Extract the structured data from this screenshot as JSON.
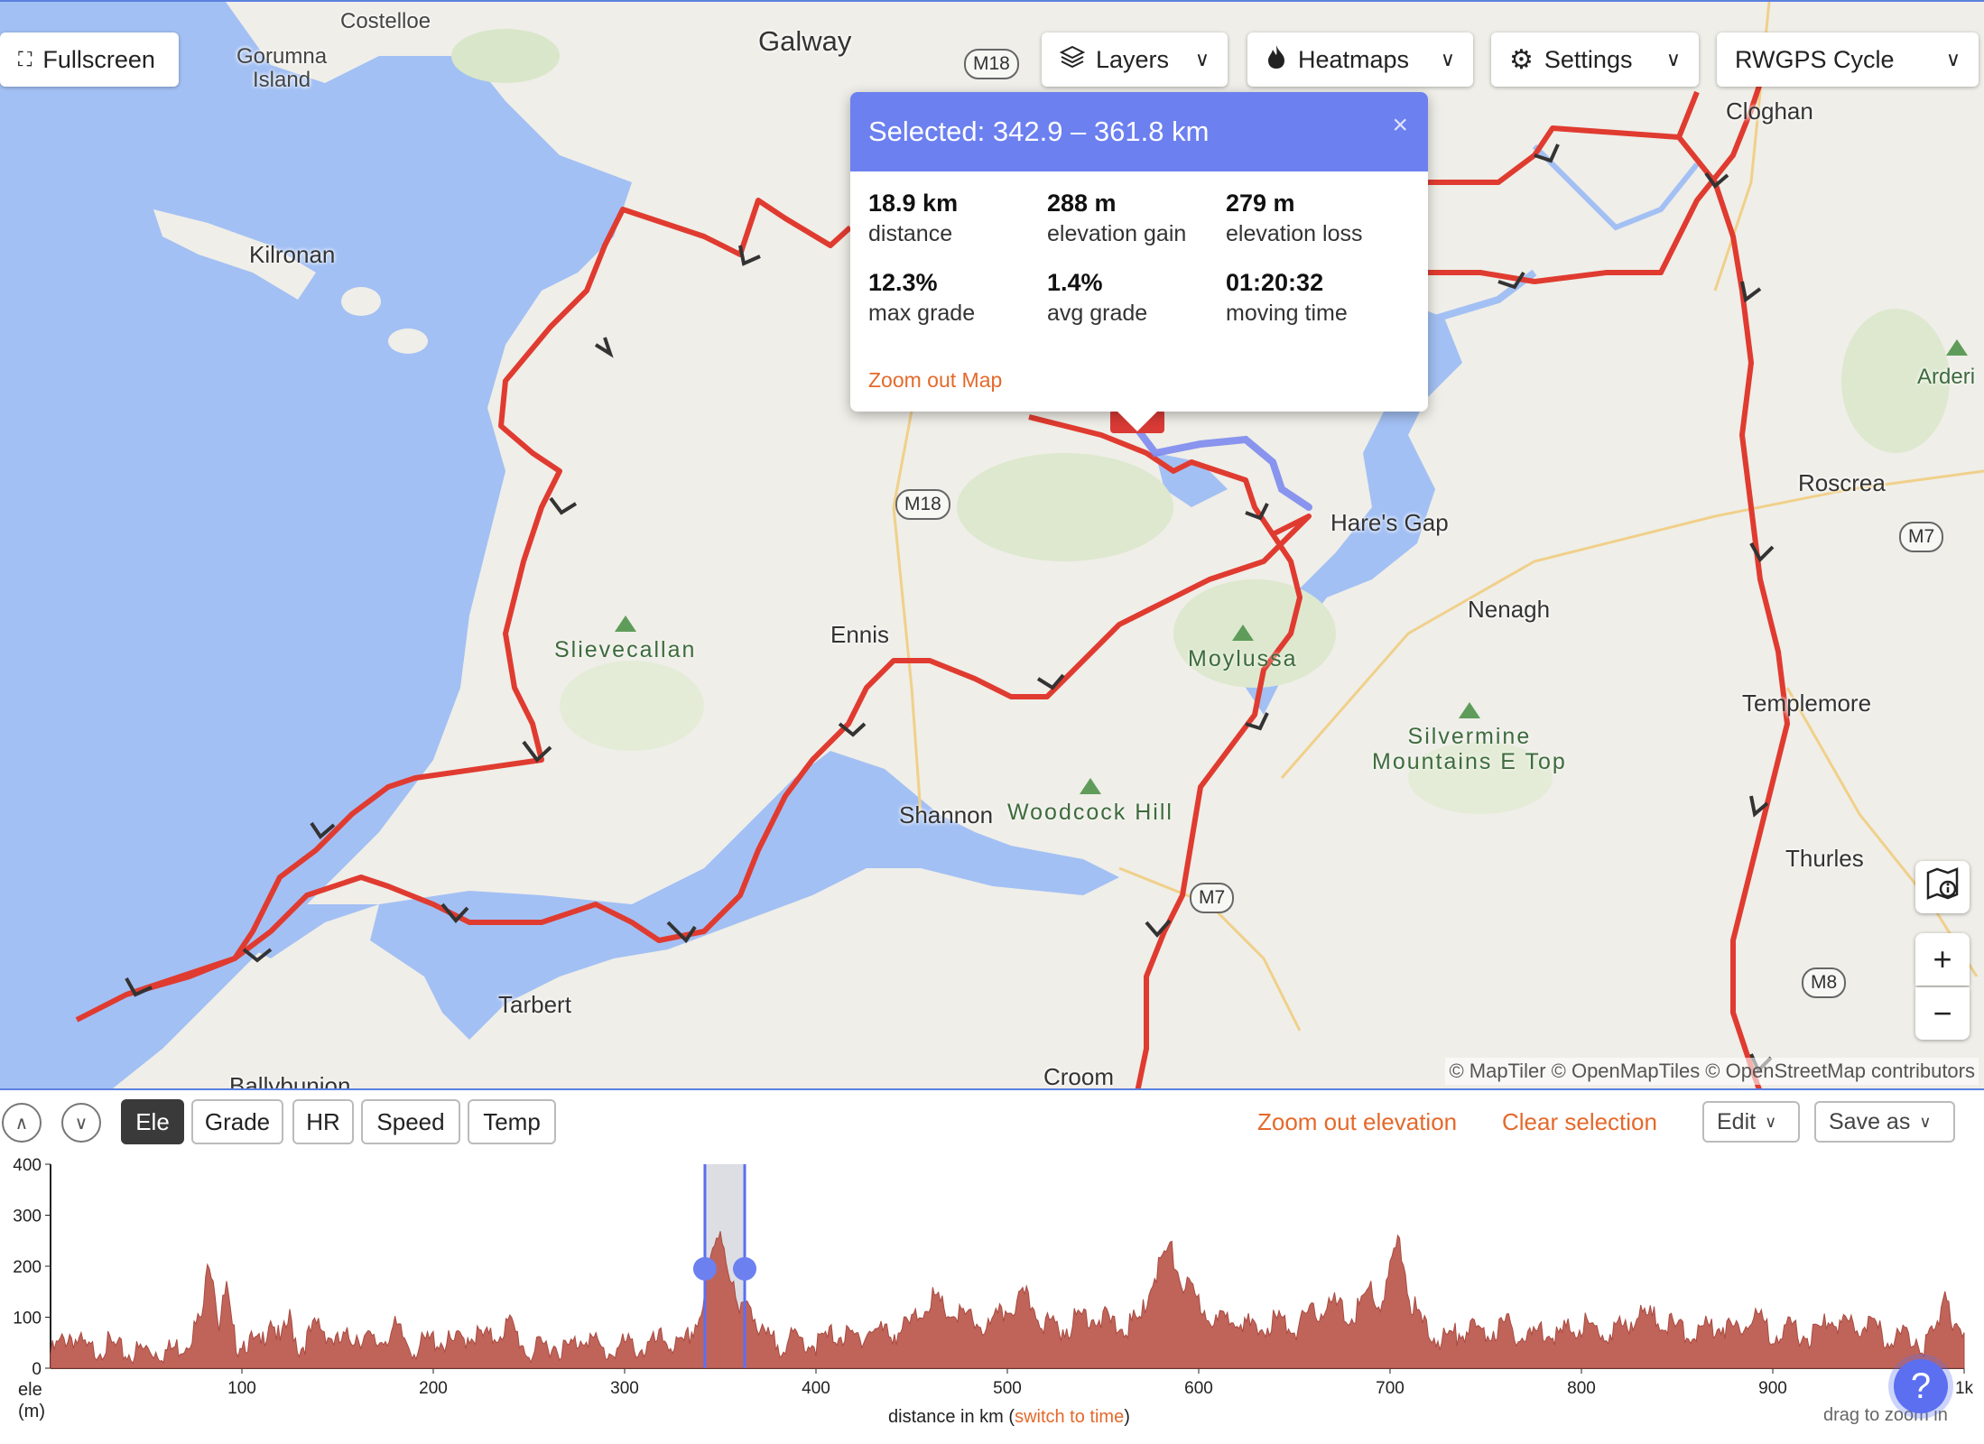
{
  "map": {
    "controls": {
      "fullscreen_label": "Fullscreen",
      "layers_label": "Layers",
      "heatmaps_label": "Heatmaps",
      "settings_label": "Settings",
      "style_label": "RWGPS Cycle"
    },
    "places": {
      "costelloe": "Costelloe",
      "gorumna_1": "Gorumna",
      "gorumna_2": "Island",
      "galway": "Galway",
      "kilronan": "Kilronan",
      "cloghan": "Cloghan",
      "roscrea": "Roscrea",
      "hares_gap": "Hare's Gap",
      "ennis": "Ennis",
      "nenagh": "Nenagh",
      "templemore": "Templemore",
      "shannon": "Shannon",
      "thurles": "Thurles",
      "tarbert": "Tarbert",
      "ballybunion": "Ballybunion",
      "croom": "Croom",
      "arderin": "Arderi"
    },
    "peaks": {
      "slievecallan": "Slievecallan",
      "moylussa": "Moylussa",
      "silvermine_1": "Silvermine",
      "silvermine_2": "Mountains E Top",
      "woodcock": "Woodcock Hill"
    },
    "roads": {
      "m18_top": "M18",
      "m18_mid": "M18",
      "m7_east": "M7",
      "m7_south": "M7",
      "m8": "M8"
    },
    "attribution": "© MapTiler © OpenMapTiles © OpenStreetMap contributors",
    "colors": {
      "water": "#a3c0f4",
      "land": "#efeee8",
      "route": "#e03b30",
      "selection": "#7684ee"
    }
  },
  "popup": {
    "title": "Selected: 342.9 – 361.8 km",
    "close_icon": "×",
    "stats": [
      {
        "value": "18.9 km",
        "label": "distance"
      },
      {
        "value": "288 m",
        "label": "elevation gain"
      },
      {
        "value": "279 m",
        "label": "elevation loss"
      },
      {
        "value": "12.3%",
        "label": "max grade"
      },
      {
        "value": "1.4%",
        "label": "avg grade"
      },
      {
        "value": "01:20:32",
        "label": "moving time"
      }
    ],
    "zoom_link": "Zoom out Map"
  },
  "toolbar": {
    "tabs": [
      "Ele",
      "Grade",
      "HR",
      "Speed",
      "Temp"
    ],
    "active_tab": "Ele",
    "zoom_out_elevation": "Zoom out elevation",
    "clear_selection": "Clear selection",
    "edit_label": "Edit",
    "save_label": "Save as"
  },
  "chart_data": {
    "type": "area",
    "ylabel_1": "ele",
    "ylabel_2": "(m)",
    "xlabel_prefix": "distance in km (",
    "xlabel_link": "switch to time",
    "xlabel_suffix": ")",
    "drag_hint": "drag to zoom in",
    "yticks": [
      "0",
      "100",
      "200",
      "300",
      "400"
    ],
    "xticks": [
      "100",
      "200",
      "300",
      "400",
      "500",
      "600",
      "700",
      "800",
      "900",
      "1k"
    ],
    "xlim": [
      0,
      1000
    ],
    "ylim": [
      0,
      400
    ],
    "selection_km": [
      342.9,
      361.8
    ],
    "profile_km": [
      0,
      10,
      20,
      30,
      40,
      50,
      60,
      70,
      80,
      82,
      85,
      88,
      92,
      95,
      98,
      100,
      110,
      115,
      120,
      125,
      130,
      140,
      150,
      160,
      170,
      180,
      190,
      200,
      210,
      220,
      230,
      240,
      250,
      260,
      270,
      280,
      290,
      300,
      310,
      320,
      330,
      340,
      345,
      350,
      355,
      360,
      365,
      370,
      380,
      390,
      400,
      410,
      420,
      430,
      440,
      450,
      460,
      470,
      480,
      490,
      500,
      510,
      520,
      530,
      540,
      550,
      560,
      570,
      575,
      580,
      585,
      590,
      600,
      610,
      620,
      630,
      640,
      650,
      660,
      670,
      680,
      690,
      695,
      700,
      705,
      710,
      720,
      730,
      740,
      750,
      760,
      770,
      780,
      790,
      800,
      810,
      820,
      830,
      840,
      850,
      860,
      870,
      880,
      890,
      900,
      910,
      920,
      930,
      940,
      950,
      960,
      970,
      980,
      985,
      990,
      995,
      1000
    ],
    "profile_ele": [
      40,
      80,
      45,
      60,
      40,
      50,
      45,
      60,
      120,
      240,
      200,
      100,
      170,
      80,
      60,
      70,
      55,
      120,
      60,
      110,
      50,
      100,
      60,
      80,
      60,
      90,
      50,
      70,
      60,
      80,
      70,
      100,
      40,
      60,
      50,
      80,
      40,
      60,
      50,
      70,
      50,
      120,
      220,
      290,
      200,
      110,
      160,
      80,
      60,
      70,
      60,
      80,
      70,
      90,
      80,
      100,
      150,
      120,
      110,
      90,
      130,
      150,
      100,
      90,
      120,
      110,
      90,
      110,
      180,
      220,
      250,
      190,
      140,
      100,
      120,
      80,
      110,
      90,
      120,
      140,
      110,
      170,
      130,
      200,
      270,
      150,
      80,
      70,
      90,
      80,
      100,
      70,
      90,
      80,
      100,
      80,
      90,
      120,
      110,
      90,
      80,
      100,
      90,
      120,
      80,
      90,
      70,
      110,
      90,
      100,
      70,
      80,
      60,
      80,
      180,
      90,
      70
    ]
  }
}
